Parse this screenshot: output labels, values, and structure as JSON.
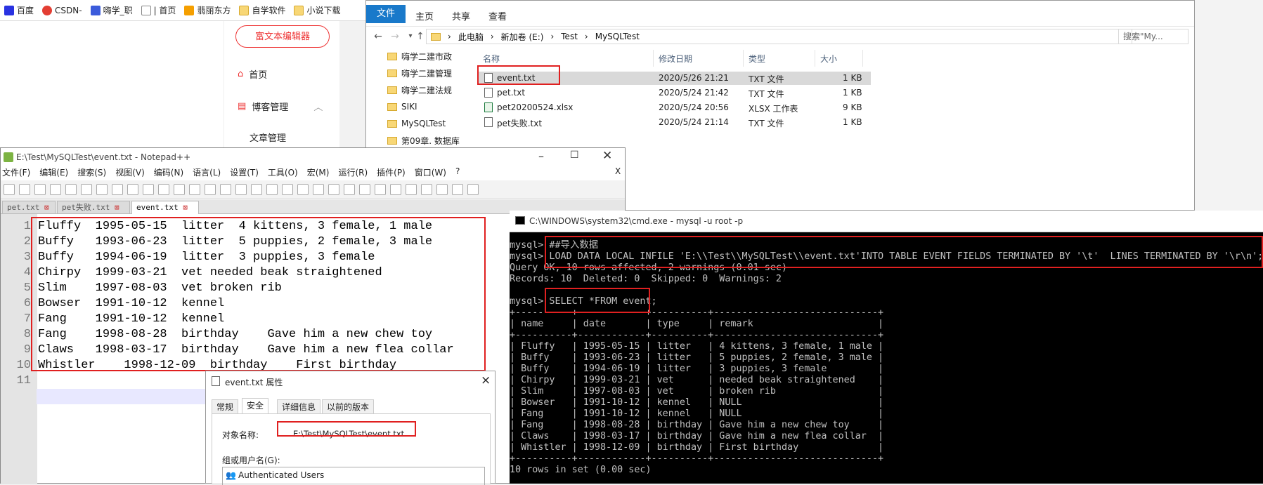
{
  "bookmarks": [
    {
      "label": "百度",
      "icon": "baidu-icon",
      "color": "#2932e1"
    },
    {
      "label": "CSDN-",
      "icon": "csdn-icon",
      "color": "#e33e33"
    },
    {
      "label": "嗨学_职",
      "icon": "haixue-icon",
      "color": "#3b5bdb"
    },
    {
      "label": "| 首页",
      "icon": "page-icon",
      "color": "#888888"
    },
    {
      "label": "翡丽东方",
      "icon": "feili-icon",
      "color": "#f59f00"
    },
    {
      "label": "自学软件",
      "icon": "folder-icon",
      "color": "#f8d776"
    },
    {
      "label": "小说下载",
      "icon": "folder-icon",
      "color": "#f8d776"
    }
  ],
  "blog": {
    "rich_editor_label": "富文本编辑器",
    "home_label": "首页",
    "blog_manage_label": "博客管理",
    "article_manage_label": "文章管理"
  },
  "explorer": {
    "ribbon": {
      "file": "文件",
      "home": "主页",
      "share": "共享",
      "view": "查看"
    },
    "breadcrumb": [
      "此电脑",
      "新加卷 (E:)",
      "Test",
      "MySQLTest"
    ],
    "search_placeholder": "搜索\"My...",
    "nav_items": [
      {
        "label": "嗨学二建市政",
        "pinned": true
      },
      {
        "label": "嗨学二建管理",
        "pinned": true
      },
      {
        "label": "嗨学二建法规",
        "pinned": true
      },
      {
        "label": "SIKI",
        "pinned": true
      },
      {
        "label": "MySQLTest",
        "pinned": false
      },
      {
        "label": "第09章. 数据库",
        "pinned": false
      }
    ],
    "columns": {
      "name": "名称",
      "modified": "修改日期",
      "type": "类型",
      "size": "大小"
    },
    "files": [
      {
        "name": "event.txt",
        "modified": "2020/5/26 21:21",
        "type": "TXT 文件",
        "size": "1 KB",
        "selected": true,
        "icon": "text-file-icon"
      },
      {
        "name": "pet.txt",
        "modified": "2020/5/24 21:42",
        "type": "TXT 文件",
        "size": "1 KB",
        "selected": false,
        "icon": "text-file-icon"
      },
      {
        "name": "pet20200524.xlsx",
        "modified": "2020/5/24 20:56",
        "type": "XLSX 工作表",
        "size": "9 KB",
        "selected": false,
        "icon": "excel-file-icon"
      },
      {
        "name": "pet失败.txt",
        "modified": "2020/5/24 21:14",
        "type": "TXT 文件",
        "size": "1 KB",
        "selected": false,
        "icon": "text-file-icon"
      }
    ]
  },
  "notepad": {
    "title": "E:\\Test\\MySQLTest\\event.txt - Notepad++",
    "menu": [
      "文件(F)",
      "编辑(E)",
      "搜索(S)",
      "视图(V)",
      "编码(N)",
      "语言(L)",
      "设置(T)",
      "工具(O)",
      "宏(M)",
      "运行(R)",
      "插件(P)",
      "窗口(W)",
      "?"
    ],
    "close_x": "X",
    "tabs": [
      {
        "label": "pet.txt",
        "active": false
      },
      {
        "label": "pet失败.txt",
        "active": false
      },
      {
        "label": "event.txt",
        "active": true
      }
    ],
    "lines": [
      "Fluffy  1995-05-15  litter  4 kittens, 3 female, 1 male",
      "Buffy   1993-06-23  litter  5 puppies, 2 female, 3 male",
      "Buffy   1994-06-19  litter  3 puppies, 3 female",
      "Chirpy  1999-03-21  vet needed beak straightened",
      "Slim    1997-08-03  vet broken rib",
      "Bowser  1991-10-12  kennel",
      "Fang    1991-10-12  kennel",
      "Fang    1998-08-28  birthday    Gave him a new chew toy",
      "Claws   1998-03-17  birthday    Gave him a new flea collar",
      "Whistler    1998-12-09  birthday    First birthday",
      ""
    ],
    "line_numbers": [
      "1",
      "2",
      "3",
      "4",
      "5",
      "6",
      "7",
      "8",
      "9",
      "10",
      "11"
    ]
  },
  "properties": {
    "title": "event.txt 属性",
    "tabs": [
      {
        "label": "常规",
        "active": false
      },
      {
        "label": "安全",
        "active": true
      },
      {
        "label": "详细信息",
        "active": false
      },
      {
        "label": "以前的版本",
        "active": false
      }
    ],
    "object_name_label": "对象名称:",
    "object_name_value": "E:\\Test\\MySQLTest\\event.txt",
    "group_label": "组或用户名(G):",
    "users": [
      "Authenticated Users"
    ],
    "close_x": "×"
  },
  "cmd": {
    "title": "C:\\WINDOWS\\system32\\cmd.exe - mysql  -u root -p",
    "lines": [
      "mysql> ##导入数据",
      "mysql> LOAD DATA LOCAL INFILE 'E:\\\\Test\\\\MySQLTest\\\\event.txt'INTO TABLE EVENT FIELDS TERMINATED BY '\\t'  LINES TERMINATED BY '\\r\\n';",
      "Query OK, 10 rows affected, 2 warnings (0.01 sec)",
      "Records: 10  Deleted: 0  Skipped: 0  Warnings: 2",
      "",
      "mysql> SELECT *FROM event;",
      "+----------+------------+----------+-----------------------------+",
      "| name     | date       | type     | remark                      |",
      "+----------+------------+----------+-----------------------------+",
      "| Fluffy   | 1995-05-15 | litter   | 4 kittens, 3 female, 1 male |",
      "| Buffy    | 1993-06-23 | litter   | 5 puppies, 2 female, 3 male |",
      "| Buffy    | 1994-06-19 | litter   | 3 puppies, 3 female         |",
      "| Chirpy   | 1999-03-21 | vet      | needed beak straightened    |",
      "| Slim     | 1997-08-03 | vet      | broken rib                  |",
      "| Bowser   | 1991-10-12 | kennel   | NULL                        |",
      "| Fang     | 1991-10-12 | kennel   | NULL                        |",
      "| Fang     | 1998-08-28 | birthday | Gave him a new chew toy     |",
      "| Claws    | 1998-03-17 | birthday | Gave him a new flea collar  |",
      "| Whistler | 1998-12-09 | birthday | First birthday              |",
      "+----------+------------+----------+-----------------------------+",
      "10 rows in set (0.00 sec)"
    ]
  },
  "colors": {
    "highlight_red": "#e02020",
    "explorer_blue": "#1979ca",
    "cmd_bg": "#000000",
    "cmd_fg": "#c0c0c0"
  }
}
